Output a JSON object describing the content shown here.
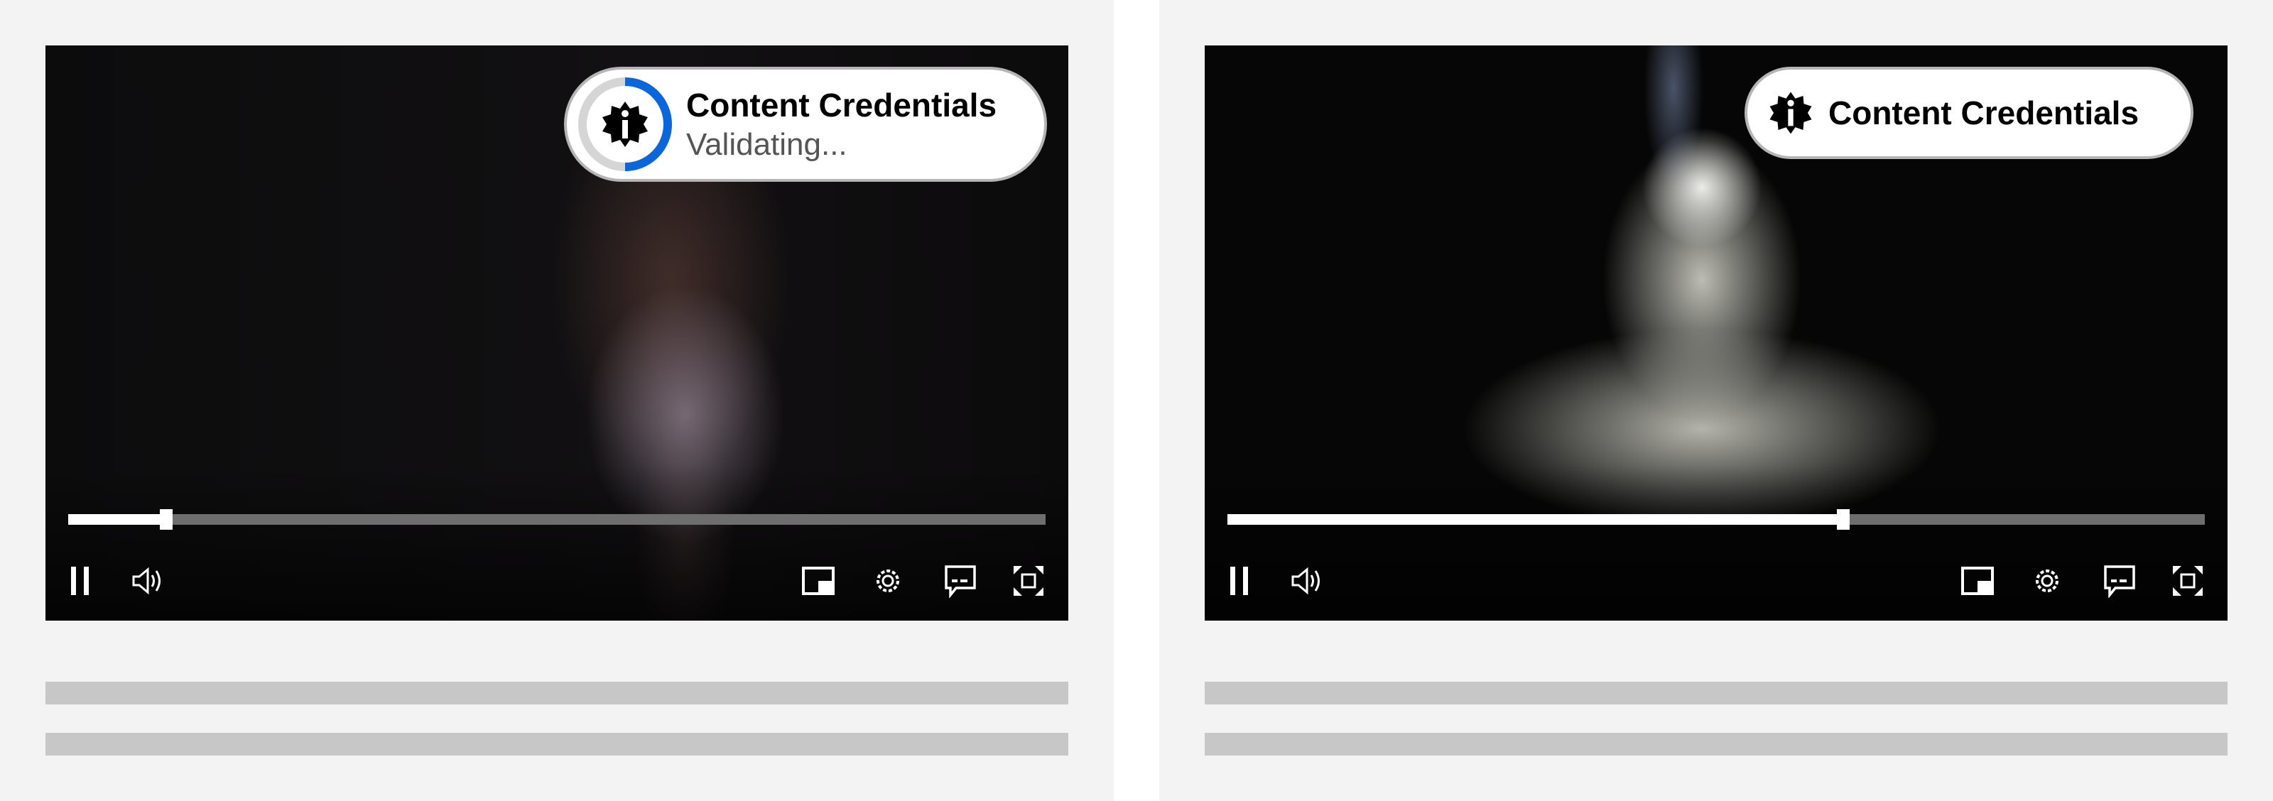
{
  "players": [
    {
      "badge": {
        "title": "Content Credentials",
        "status": "Validating...",
        "icon": "info-seal-icon",
        "spinner_color": "#0a66dc"
      },
      "progress_percent": 10
    },
    {
      "badge": {
        "title": "Content Credentials",
        "icon": "info-seal-icon"
      },
      "progress_percent": 63
    }
  ],
  "controls": [
    "pause-icon",
    "volume-icon",
    "picture-in-picture-icon",
    "settings-icon",
    "captions-icon",
    "fullscreen-icon"
  ]
}
